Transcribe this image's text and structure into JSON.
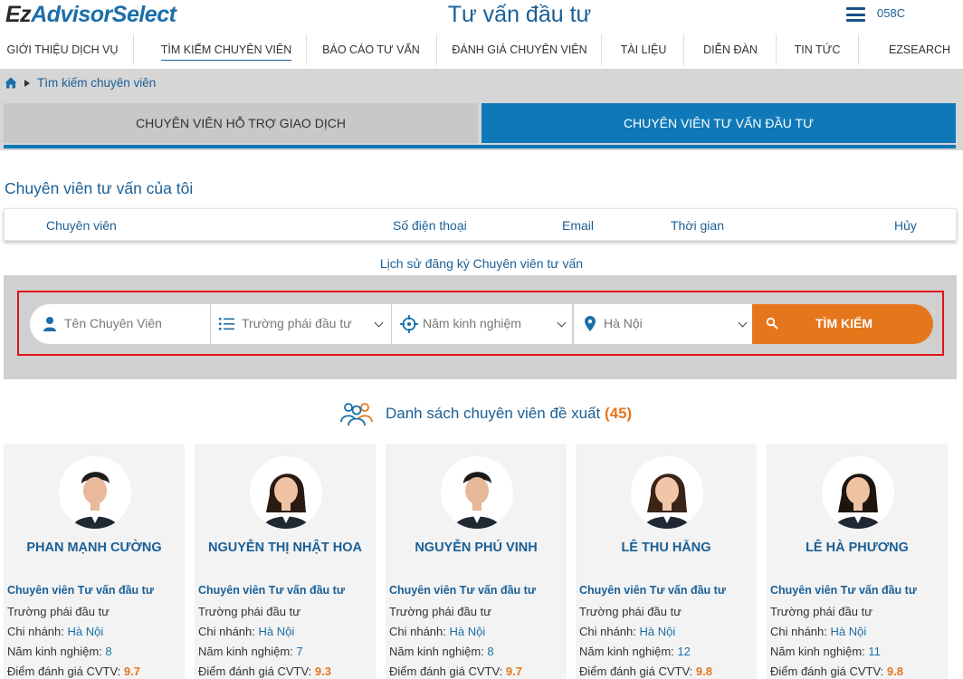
{
  "header": {
    "logo_ez": "Ez",
    "logo_rest": "AdvisorSelect",
    "title": "Tư vấn đầu tư",
    "account": "058C"
  },
  "nav": [
    {
      "label": "GIỚI THIỆU DỊCH VỤ"
    },
    {
      "label": "TÌM KIẾM CHUYÊN VIÊN"
    },
    {
      "label": "BÁO CÁO TƯ VẤN"
    },
    {
      "label": "ĐÁNH GIÁ CHUYÊN VIÊN"
    },
    {
      "label": "TÀI LIỆU"
    },
    {
      "label": "DIỄN ĐÀN"
    },
    {
      "label": "TIN TỨC"
    },
    {
      "label": "EZSEARCH"
    }
  ],
  "breadcrumb": {
    "current": "Tìm kiếm chuyên viên"
  },
  "tabs": {
    "left": "CHUYÊN VIÊN HỖ TRỢ GIAO DỊCH",
    "right": "CHUYÊN VIÊN TƯ VẤN ĐẦU TƯ"
  },
  "my_advisors": {
    "title": "Chuyên viên tư vấn của tôi",
    "columns": [
      "Chuyên viên",
      "Số điện thoại",
      "Email",
      "Thời gian",
      "Hủy"
    ]
  },
  "history_link": "Lịch sử đăng ký Chuyên viên tư vấn",
  "search": {
    "name_placeholder": "Tên Chuyên Viên",
    "style_value": "Trường phái đầu tư",
    "experience_value": "Năm kinh nghiệm",
    "location_value": "Hà Nội",
    "button": "TÌM KIẾM"
  },
  "suggestions": {
    "title": "Danh sách chuyên viên đề xuất",
    "count": "(45)"
  },
  "labels": {
    "style": "Trường phái đầu tư",
    "branch": "Chi nhánh: ",
    "experience": "Năm kinh nghiệm: ",
    "score": "Điểm đánh giá CVTV: "
  },
  "advisors": [
    {
      "name": "PHAN MẠNH CƯỜNG",
      "role": "Chuyên viên Tư vấn đầu tư",
      "branch": "Hà Nội",
      "experience": "8",
      "score": "9.7"
    },
    {
      "name": "NGUYỄN THỊ NHẬT HOA",
      "role": "Chuyên viên Tư vấn đầu tư",
      "branch": "Hà Nội",
      "experience": "7",
      "score": "9.3"
    },
    {
      "name": "NGUYỄN PHÚ VINH",
      "role": "Chuyên viên Tư vấn đầu tư",
      "branch": "Hà Nội",
      "experience": "8",
      "score": "9.7"
    },
    {
      "name": "LÊ THU HẰNG",
      "role": "Chuyên viên Tư vấn đầu tư",
      "branch": "Hà Nội",
      "experience": "12",
      "score": "9.8"
    },
    {
      "name": "LÊ HÀ PHƯƠNG",
      "role": "Chuyên viên Tư vấn đầu tư",
      "branch": "Hà Nội",
      "experience": "11",
      "score": "9.8"
    }
  ],
  "colors": {
    "brand": "#1a5f96",
    "accent": "#e5761c",
    "tab_active": "#0f78b8",
    "highlight_border": "#e0141a"
  }
}
